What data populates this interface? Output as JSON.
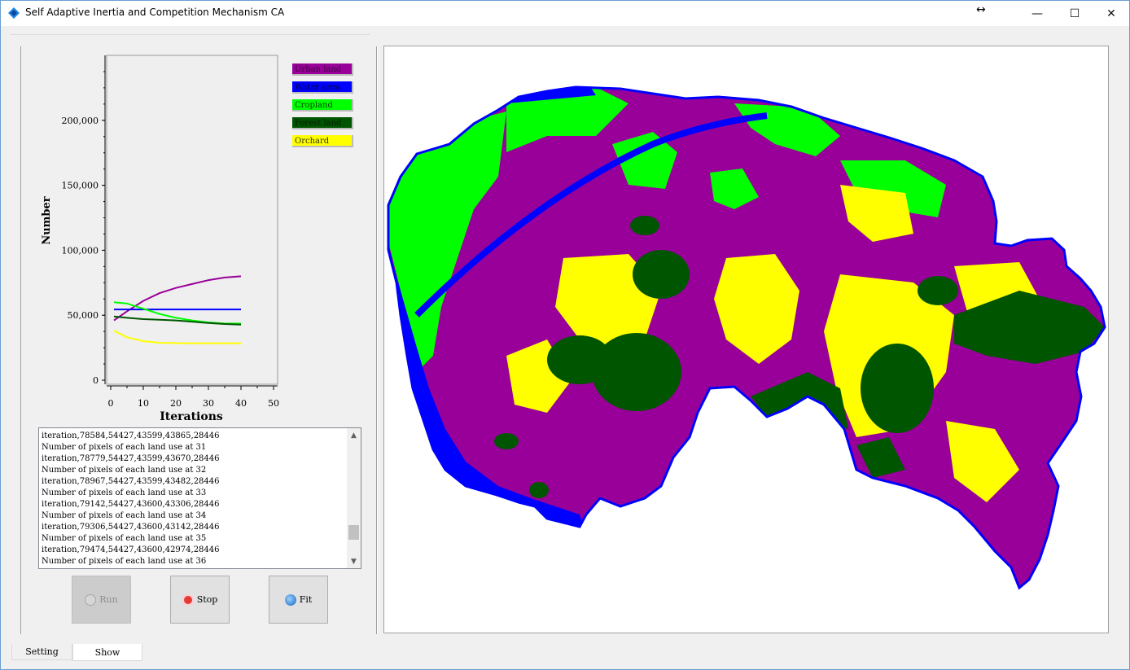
{
  "window": {
    "title": "Self Adaptive Inertia and Competition Mechanism CA",
    "minimize": "—",
    "maximize": "☐",
    "close": "✕",
    "resize_glyph": "↔"
  },
  "chart_data": {
    "type": "line",
    "xlabel": "Iterations",
    "ylabel": "Number",
    "xlim": [
      0,
      50
    ],
    "ylim": [
      0,
      250000
    ],
    "x_ticks": [
      "0",
      "10",
      "20",
      "30",
      "40",
      "50"
    ],
    "y_ticks": [
      "0",
      "50,000",
      "100,000",
      "150,000",
      "200,000"
    ],
    "legend_position": "right",
    "x": [
      1,
      5,
      10,
      15,
      20,
      25,
      30,
      35,
      40
    ],
    "series": [
      {
        "name": "Urban land",
        "color": "#990099",
        "values": [
          46000,
          53000,
          61000,
          67000,
          71000,
          74000,
          77000,
          79000,
          80000
        ]
      },
      {
        "name": "Water area",
        "color": "#0000ff",
        "values": [
          54427,
          54427,
          54427,
          54427,
          54427,
          54427,
          54427,
          54427,
          54427
        ]
      },
      {
        "name": "Cropland",
        "color": "#00ff00",
        "values": [
          60000,
          59000,
          55000,
          51000,
          48000,
          46000,
          44500,
          43600,
          43600
        ]
      },
      {
        "name": "Forest land",
        "color": "#005500",
        "values": [
          49000,
          48000,
          47000,
          46500,
          46000,
          45000,
          44000,
          43200,
          42800
        ]
      },
      {
        "name": "Orchard",
        "color": "#ffff00",
        "values": [
          38000,
          33000,
          30000,
          28800,
          28500,
          28446,
          28446,
          28446,
          28446
        ]
      }
    ]
  },
  "log": {
    "lines": [
      "iteration,78584,54427,43599,43865,28446",
      "Number of pixels of each land use at 31",
      "iteration,78779,54427,43599,43670,28446",
      "Number of pixels of each land use at 32",
      "iteration,78967,54427,43599,43482,28446",
      "Number of pixels of each land use at 33",
      "iteration,79142,54427,43600,43306,28446",
      "Number of pixels of each land use at 34",
      "iteration,79306,54427,43600,43142,28446",
      "Number of pixels of each land use at 35",
      "iteration,79474,54427,43600,42974,28446",
      "Number of pixels of each land use at 36"
    ]
  },
  "buttons": {
    "run": "Run",
    "stop": "Stop",
    "fit": "Fit"
  },
  "tabs": {
    "setting": "Setting",
    "show": "Show"
  },
  "map": {
    "colors": {
      "urban": "#990099",
      "water": "#0000ff",
      "cropland": "#00ff00",
      "forest": "#005500",
      "orchard": "#ffff00"
    }
  }
}
